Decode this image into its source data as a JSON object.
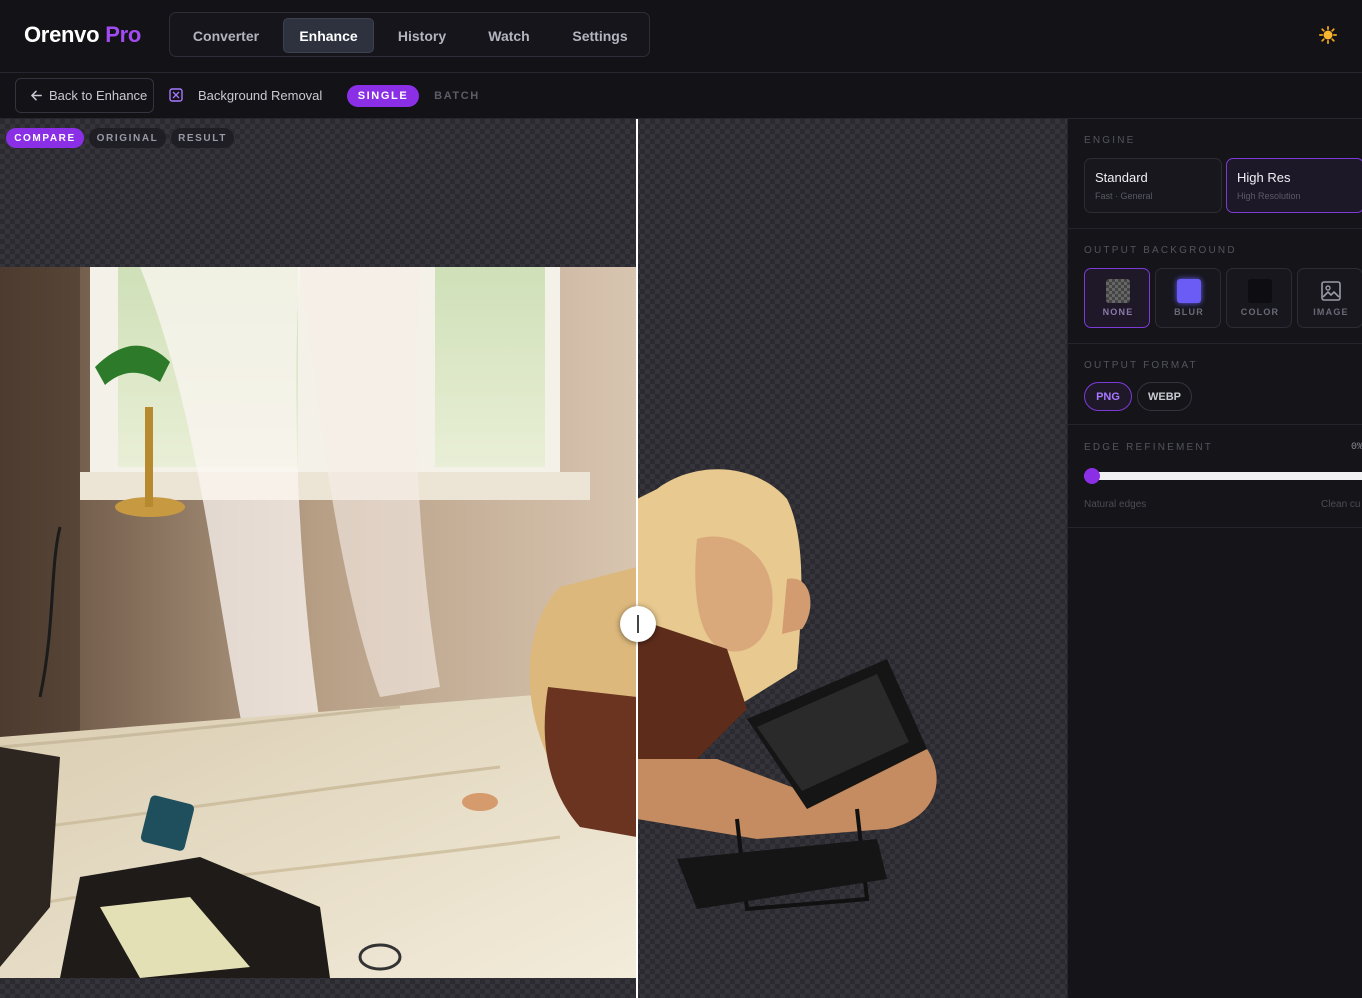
{
  "app": {
    "brand_primary": "Orenvo",
    "brand_accent": "Pro",
    "accent_color": "#8b2fe6"
  },
  "nav": {
    "tabs": [
      {
        "label": "Converter",
        "active": false
      },
      {
        "label": "Enhance",
        "active": true
      },
      {
        "label": "History",
        "active": false
      },
      {
        "label": "Watch",
        "active": false
      },
      {
        "label": "Settings",
        "active": false
      }
    ],
    "theme_icon": "sun-icon"
  },
  "toolbar": {
    "back_label": "Back to Enhance",
    "back_icon": "arrow-left-icon",
    "tool_icon": "background-removal-icon",
    "tool_title": "Background Removal",
    "mode_single": "SINGLE",
    "mode_batch": "BATCH",
    "active_mode": "SINGLE"
  },
  "canvas": {
    "views": [
      {
        "label": "COMPARE",
        "active": true
      },
      {
        "label": "ORIGINAL",
        "active": false
      },
      {
        "label": "RESULT",
        "active": false
      }
    ],
    "compare_position_percent": 60,
    "handle_icon": "compare-handle-icon"
  },
  "panel": {
    "engine": {
      "title": "ENGINE",
      "options": [
        {
          "title": "Standard",
          "subtitle": "Fast · General",
          "active": false
        },
        {
          "title": "High Res",
          "subtitle": "High Resolution",
          "active": true
        }
      ]
    },
    "output_background": {
      "title": "OUTPUT BACKGROUND",
      "options": [
        {
          "label": "NONE",
          "icon": "transparent-swatch-icon",
          "active": true
        },
        {
          "label": "BLUR",
          "icon": "blur-swatch-icon",
          "active": false
        },
        {
          "label": "COLOR",
          "icon": "color-swatch-icon",
          "active": false
        },
        {
          "label": "IMAGE",
          "icon": "image-icon",
          "active": false
        }
      ]
    },
    "output_format": {
      "title": "OUTPUT FORMAT",
      "options": [
        {
          "label": "PNG",
          "active": true
        },
        {
          "label": "WEBP",
          "active": false
        }
      ]
    },
    "edge_refinement": {
      "title": "EDGE REFINEMENT",
      "value_label": "0%",
      "value": 0,
      "min_label": "Natural edges",
      "max_label": "Clean cu"
    }
  }
}
